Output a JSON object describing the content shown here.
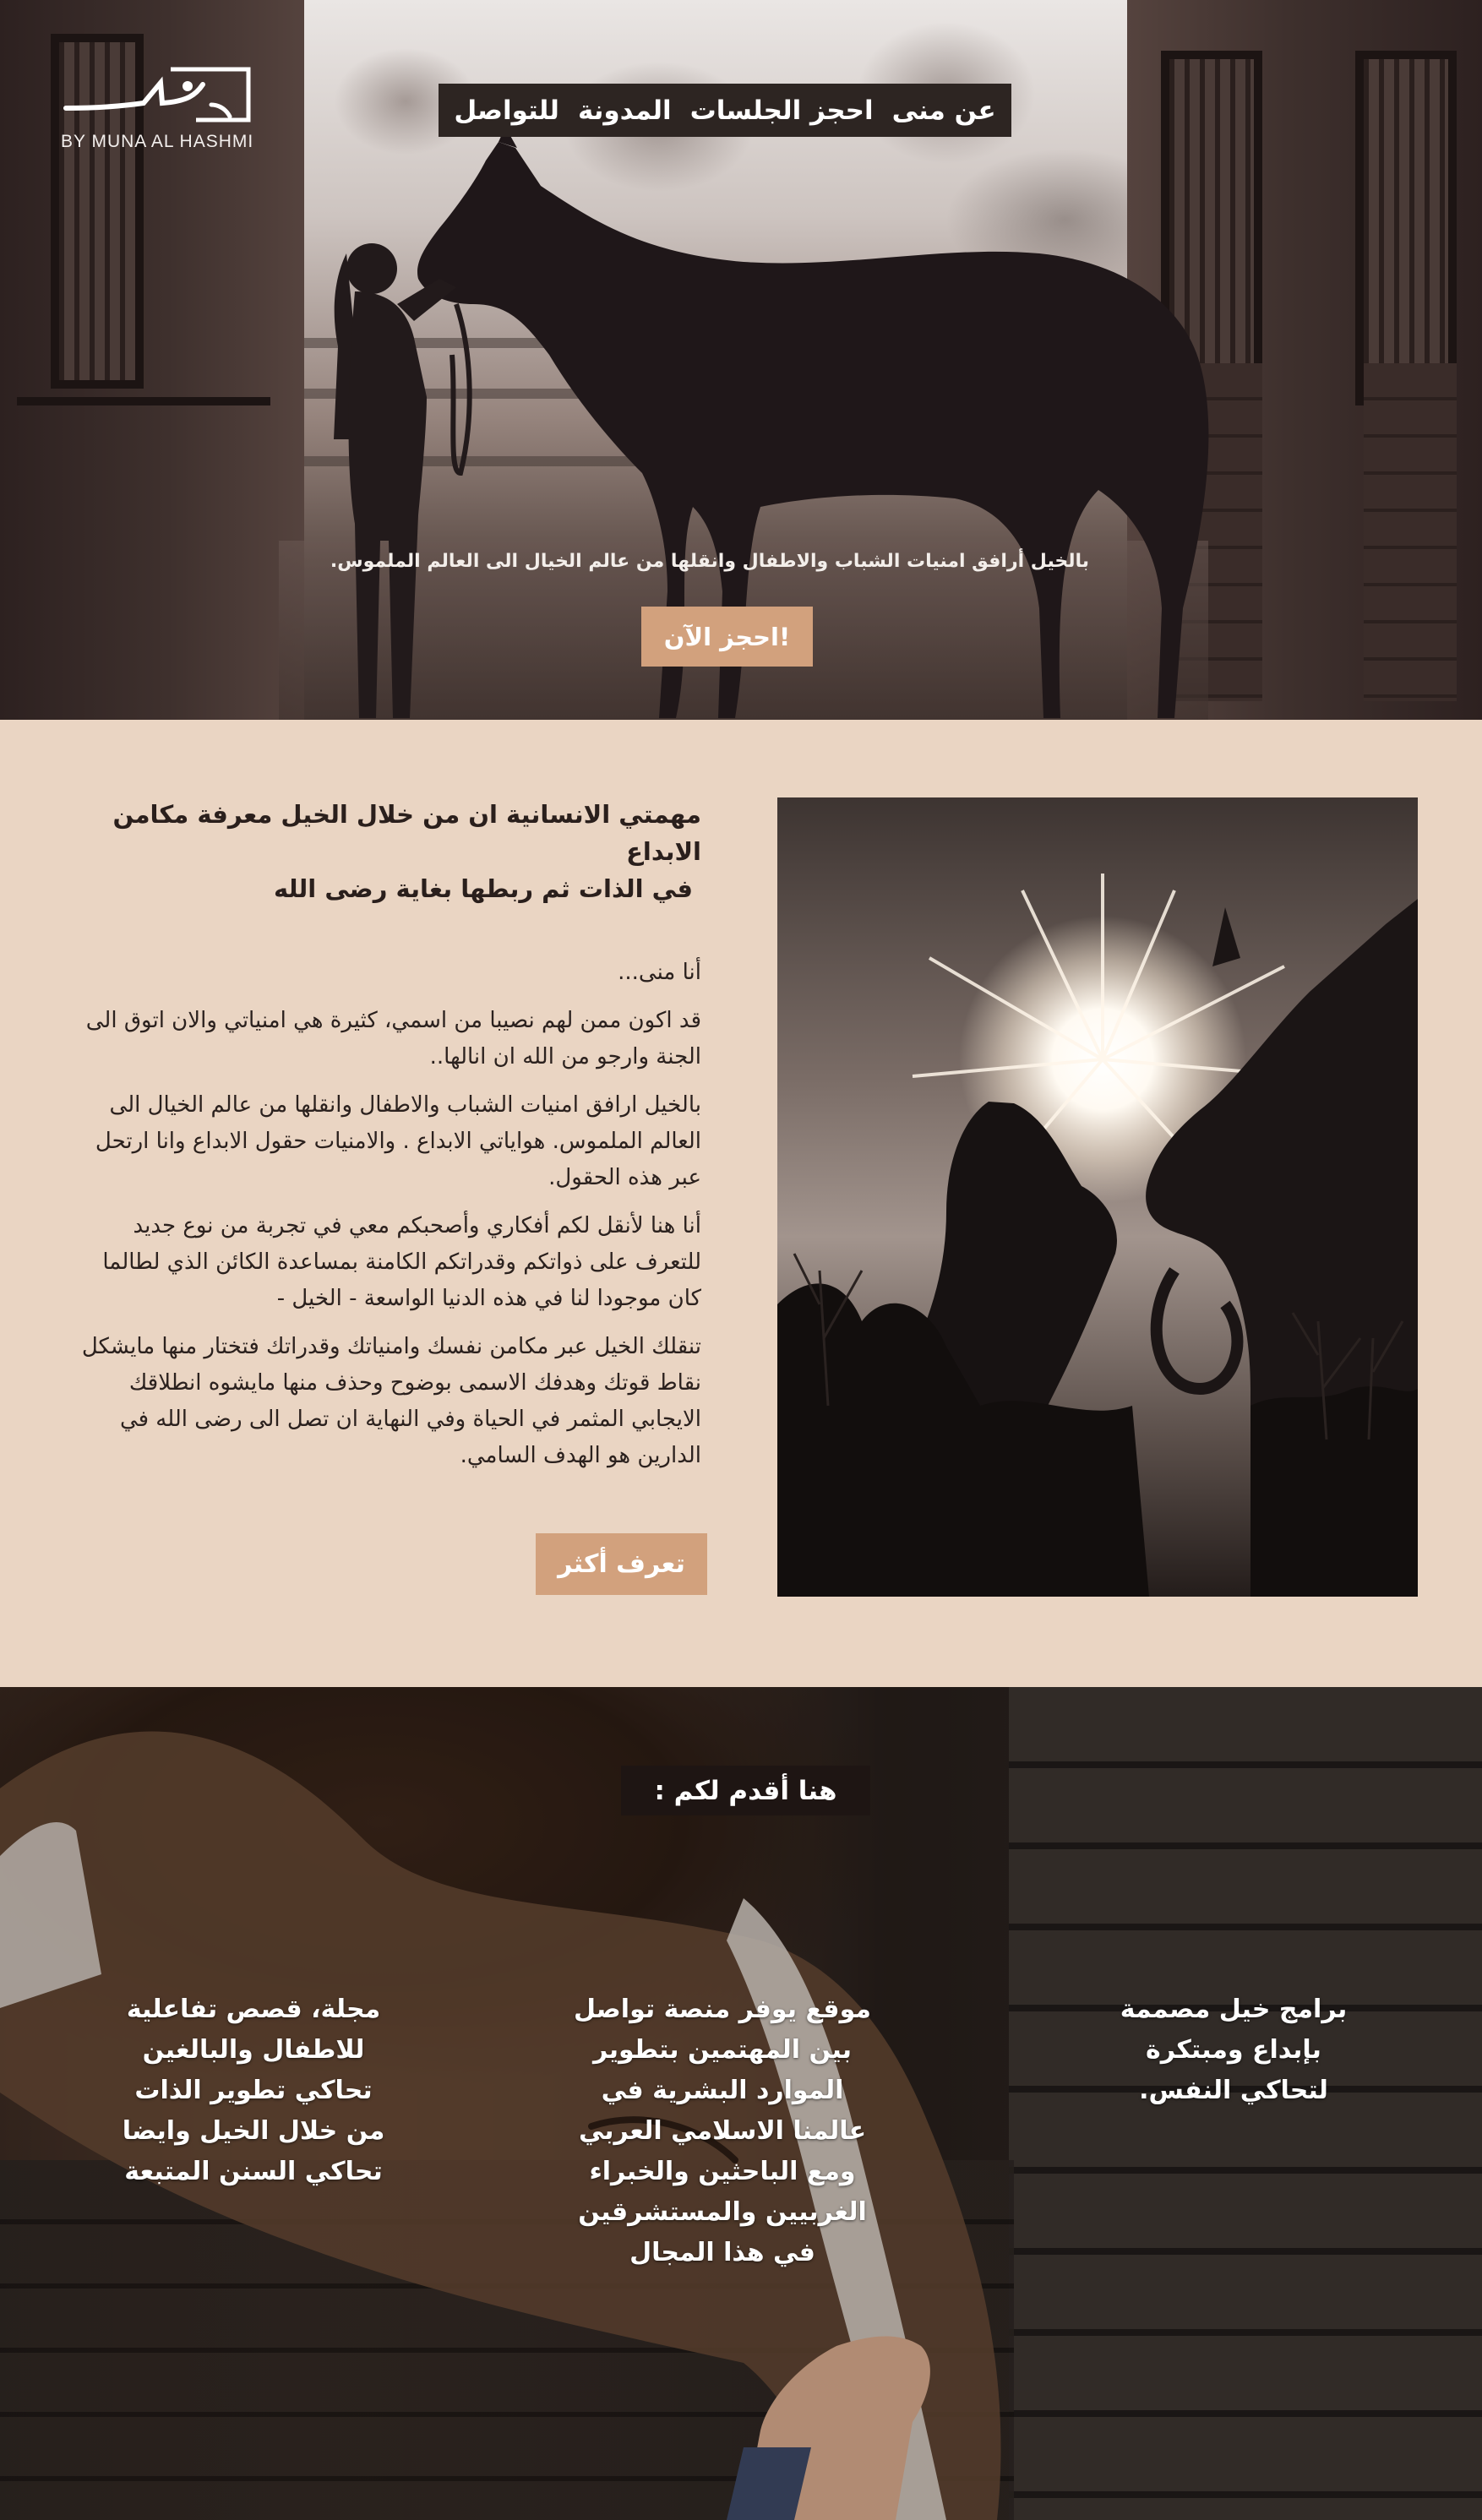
{
  "logo": {
    "tagline": "BY MUNA AL HASHMI"
  },
  "nav": {
    "items": [
      {
        "label": "عن منى"
      },
      {
        "label": "احجز الجلسات"
      },
      {
        "label": "المدونة"
      },
      {
        "label": "للتواصل"
      }
    ]
  },
  "hero": {
    "tagline": "بالخيل أرافق امنيات الشباب والاطفال وانقلها من عالم الخيال الى العالم الملموس.",
    "cta_label": "احجز الآن!"
  },
  "about": {
    "heading_lines": [
      "مهمتي الانسانية ان من خلال الخيل معرفة مكامن الابداع",
      "في الذات ثم ربطها بغاية رضى الله"
    ],
    "paragraphs": [
      "أنا منى...",
      "قد اكون ممن لهم نصيبا من اسمي، كثيرة هي امنياتي والان اتوق الى الجنة وارجو من الله ان انالها..",
      "بالخيل ارافق امنيات الشباب والاطفال وانقلها من عالم الخيال الى العالم   الملموس. هواياتي الابداع . والامنيات حقول الابداع وانا ارتحل عبر هذه الحقول.",
      "أنا هنا لأنقل لكم أفكاري وأصحبكم معي في تجربة من نوع جديد للتعرف على ذواتكم وقدراتكم الكامنة بمساعدة الكائن الذي لطالما كان موجودا لنا في هذه الدنيا الواسعة - الخيل -",
      "تنقلك الخيل عبر مكامن نفسك وامنياتك وقدراتك فتختار منها مايشكل نقاط قوتك وهدفك الاسمى بوضوح وحذف منها مايشوه انطلاقك الايجابي المثمر في الحياة وفي النهاية ان تصل الى رضى الله في الدارين هو الهدف السامي."
    ],
    "cta_label": "تعرف أكثر"
  },
  "services": {
    "title": "هنا أقدم لكم :",
    "columns": [
      {
        "lines": [
          "برامج خيل مصممة",
          "بإبداع ومبتكرة",
          "لتحاكي النفس."
        ]
      },
      {
        "lines": [
          "موقع يوفر منصة تواصل",
          "بين المهتمين بتطوير",
          "الموارد البشرية في",
          "عالمنا الاسلامي العربي",
          "ومع الباحثين والخبراء",
          "الغربيين والمستشرقين",
          "في هذا المجال"
        ]
      },
      {
        "lines": [
          "مجلة، قصص تفاعلية",
          "للاطفال والبالغين",
          "تحاكي تطوير الذات",
          "من خلال الخيل وايضا",
          "تحاكي السنن المتبعة"
        ]
      }
    ]
  },
  "colors": {
    "page_bg": "#ead5c3",
    "accent": "#d2a17d",
    "nav_bg": "#2d2522",
    "services_title_bg": "#1e1513"
  }
}
